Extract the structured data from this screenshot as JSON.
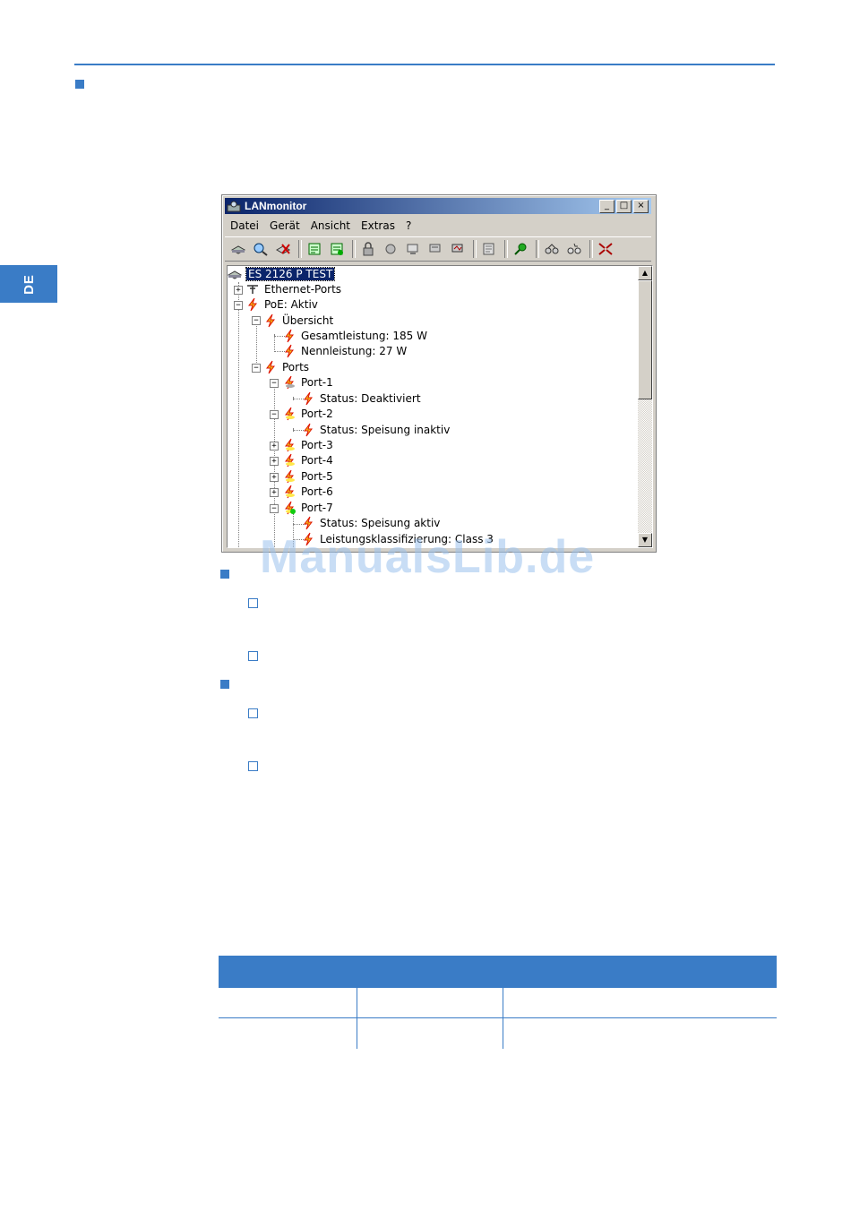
{
  "page": {
    "side_tab_label": "DE",
    "watermark": "ManualsLib.de",
    "accent_color": "#3a7cc6"
  },
  "window": {
    "title": "LANmonitor",
    "controls": {
      "minimize": "_",
      "maximize": "□",
      "close": "×"
    },
    "menu": [
      "Datei",
      "Gerät",
      "Ansicht",
      "Extras",
      "?"
    ],
    "toolbar_icons": [
      "device-icon",
      "search-device-icon",
      "delete-device-icon",
      "refresh-icon",
      "refresh-all-icon",
      "lock-icon",
      "tool-icon",
      "monitor-icon",
      "monitor-config-icon",
      "monitor-trace-icon",
      "log-icon",
      "green-key-icon",
      "network-icon",
      "network-wizard-icon",
      "collapse-icon"
    ]
  },
  "tree": {
    "root": "ES 2126 P TEST",
    "ethernet_ports": "Ethernet-Ports",
    "poe": "PoE: Aktiv",
    "overview": "Übersicht",
    "total_power": "Gesamtleistung: 185 W",
    "nominal_power": "Nennleistung: 27 W",
    "ports": "Ports",
    "port1": "Port-1",
    "port1_status": "Status: Deaktiviert",
    "port2": "Port-2",
    "port2_status": "Status: Speisung inaktiv",
    "port3": "Port-3",
    "port4": "Port-4",
    "port5": "Port-5",
    "port6": "Port-6",
    "port7": "Port-7",
    "port7_status": "Status: Speisung aktiv",
    "port7_class": "Leistungsklassifizierung: Class 3"
  }
}
